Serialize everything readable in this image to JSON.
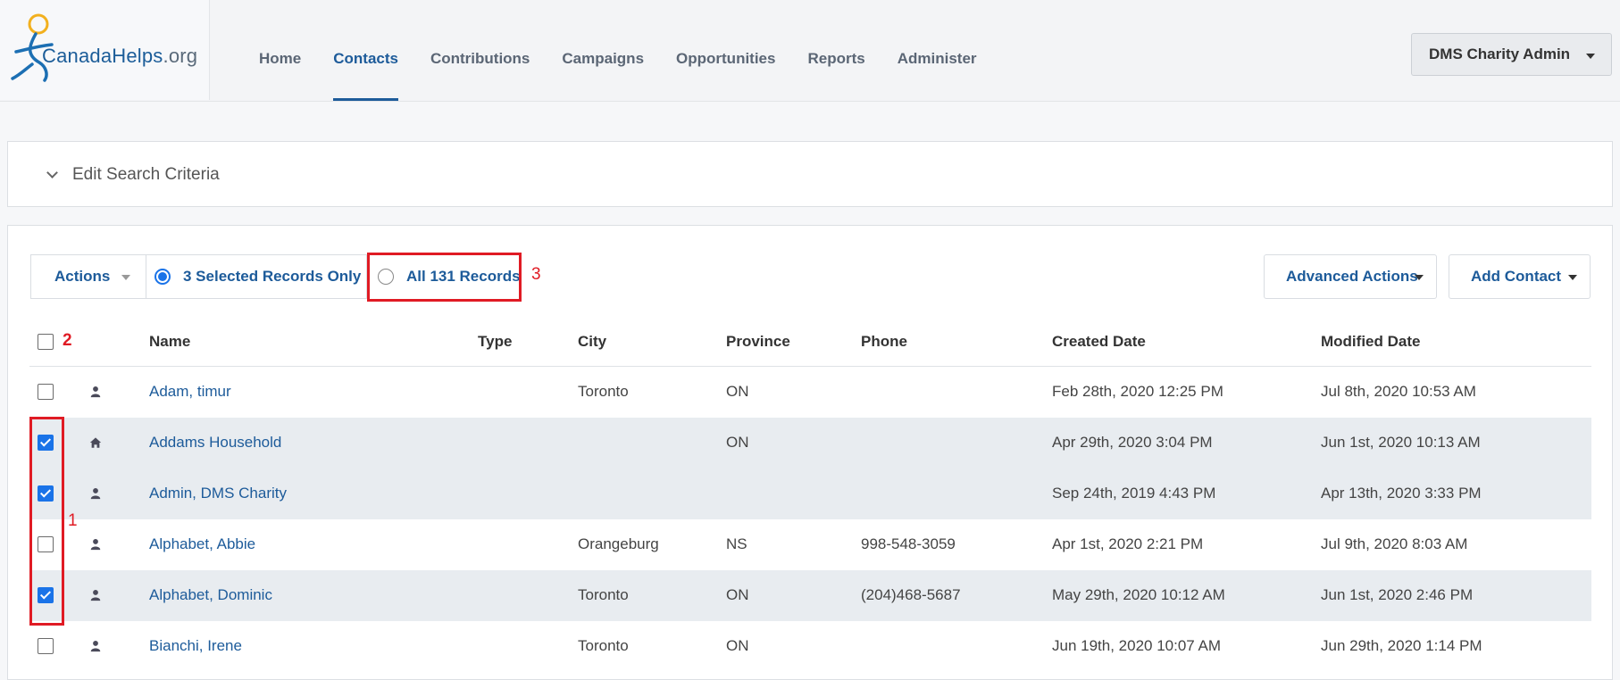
{
  "header": {
    "logo": {
      "brand": "CanadaHelps",
      "suffix": ".org"
    },
    "nav": [
      {
        "label": "Home",
        "active": false
      },
      {
        "label": "Contacts",
        "active": true
      },
      {
        "label": "Contributions",
        "active": false
      },
      {
        "label": "Campaigns",
        "active": false
      },
      {
        "label": "Opportunities",
        "active": false
      },
      {
        "label": "Reports",
        "active": false
      },
      {
        "label": "Administer",
        "active": false
      }
    ],
    "user_menu_label": "DMS Charity Admin"
  },
  "criteria": {
    "title": "Edit Search Criteria"
  },
  "toolbar": {
    "actions_label": "Actions",
    "selected_option_label": "3 Selected Records Only",
    "all_option_label": "All 131 Records",
    "selected_option_checked": true,
    "advanced_actions_label": "Advanced Actions",
    "add_contact_label": "Add Contact"
  },
  "annotations": {
    "one": "1",
    "two": "2",
    "three": "3"
  },
  "table": {
    "columns": [
      "Name",
      "Type",
      "City",
      "Province",
      "Phone",
      "Created Date",
      "Modified Date"
    ],
    "rows": [
      {
        "checked": false,
        "icon": "person-icon",
        "name": "Adam, timur",
        "type": "",
        "city": "Toronto",
        "province": "ON",
        "phone": "",
        "created": "Feb 28th, 2020 12:25 PM",
        "modified": "Jul 8th, 2020 10:53 AM"
      },
      {
        "checked": true,
        "icon": "home-icon",
        "name": "Addams Household",
        "type": "",
        "city": "",
        "province": "ON",
        "phone": "",
        "created": "Apr 29th, 2020 3:04 PM",
        "modified": "Jun 1st, 2020 10:13 AM"
      },
      {
        "checked": true,
        "icon": "person-icon",
        "name": "Admin, DMS Charity",
        "type": "",
        "city": "",
        "province": "",
        "phone": "",
        "created": "Sep 24th, 2019 4:43 PM",
        "modified": "Apr 13th, 2020 3:33 PM"
      },
      {
        "checked": false,
        "icon": "person-icon",
        "name": "Alphabet, Abbie",
        "type": "",
        "city": "Orangeburg",
        "province": "NS",
        "phone": "998-548-3059",
        "created": "Apr 1st, 2020 2:21 PM",
        "modified": "Jul 9th, 2020 8:03 AM"
      },
      {
        "checked": true,
        "icon": "person-icon",
        "name": "Alphabet, Dominic",
        "type": "",
        "city": "Toronto",
        "province": "ON",
        "phone": "(204)468-5687",
        "created": "May 29th, 2020 10:12 AM",
        "modified": "Jun 1st, 2020 2:46 PM"
      },
      {
        "checked": false,
        "icon": "person-icon",
        "name": "Bianchi, Irene",
        "type": "",
        "city": "Toronto",
        "province": "ON",
        "phone": "",
        "created": "Jun 19th, 2020 10:07 AM",
        "modified": "Jun 29th, 2020 1:14 PM"
      }
    ]
  },
  "colors": {
    "link": "#1d5b9a",
    "highlight": "#e01b24",
    "checkbox": "#1a73e8",
    "row_shade": "#e8ecf0"
  }
}
